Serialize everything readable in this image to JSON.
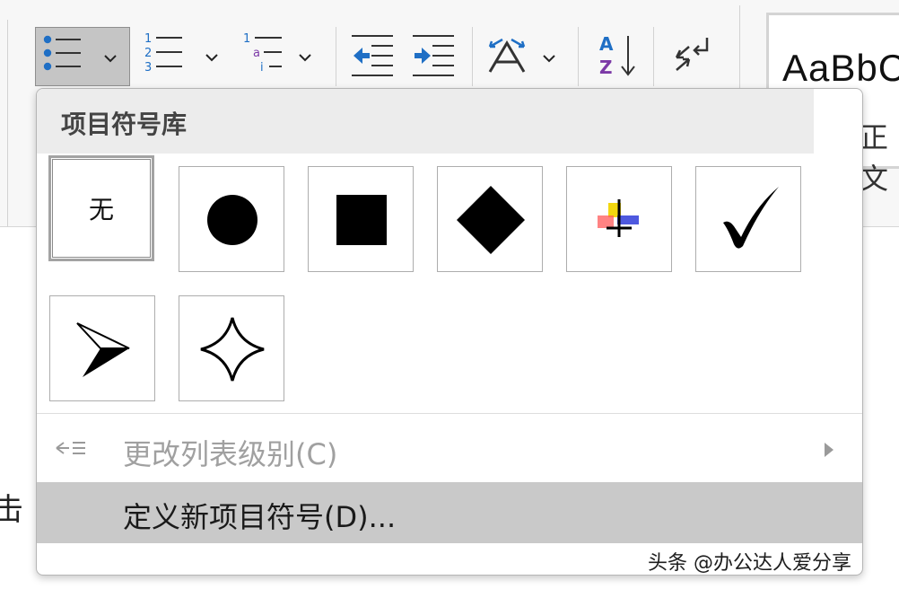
{
  "ribbon": {
    "style_sample": "AaBbC",
    "style_caption": "正文",
    "buttons": [
      "bullets",
      "numbering",
      "multilevel-list",
      "decrease-indent",
      "increase-indent",
      "text-direction",
      "sort",
      "show-marks"
    ]
  },
  "document": {
    "partial_text": "击"
  },
  "menu": {
    "title": "项目符号库",
    "bullets": [
      {
        "name": "none",
        "label": "无",
        "selected": true
      },
      {
        "name": "filled-circle"
      },
      {
        "name": "filled-square"
      },
      {
        "name": "filled-diamond"
      },
      {
        "name": "colored-cross-symbol"
      },
      {
        "name": "checkmark"
      },
      {
        "name": "arrowhead"
      },
      {
        "name": "four-point-star"
      }
    ],
    "items": [
      {
        "label": "更改列表级别(C)",
        "enabled": false,
        "has_submenu": true
      },
      {
        "label": "定义新项目符号(D)...",
        "enabled": true,
        "highlighted": true
      }
    ]
  },
  "watermark": "头条 @办公达人爱分享",
  "colors": {
    "highlight": "#c9c9c9",
    "disabled_text": "#a0a0a0",
    "icon_blue": "#1f6fc5",
    "icon_purple": "#7c3aa7"
  }
}
